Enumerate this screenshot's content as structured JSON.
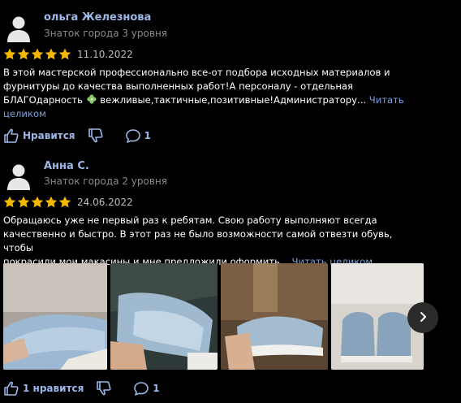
{
  "reviews": [
    {
      "author": "ольга Железнова",
      "level": "Знаток города 3 уровня",
      "rating": 5,
      "date": "11.10.2022",
      "text_line1": "В этой мастерской профессионально все-от подбора исходных материалов и",
      "text_line2": "фурнитуры до качества выполненных работ!А персоналу - отдельная",
      "text_line3_a": "БЛАГОдарность",
      "text_line3_b": " вежливые,тактичные,позитивные!Администратору...",
      "more_label_1": " Читать",
      "more_label_2": "целиком",
      "like_label": "Нравится",
      "comments_count": "1"
    },
    {
      "author": "Анна С.",
      "level": "Знаток города 2 уровня",
      "rating": 5,
      "date": "24.06.2022",
      "text_line1": "Обращаюсь уже не первый раз к ребятам. Свою работу выполняют всегда",
      "text_line2": "качественно и быстро. В этот раз не было возможности самой отвезти обувь, чтобы",
      "text_line3": "покрасили мои макасины и мне предложили оформить...",
      "more_label": " Читать целиком",
      "like_label": "1 нравится",
      "comments_count": "1",
      "photos": [
        {
          "name": "Photo 1",
          "color": "#8fa6bd"
        },
        {
          "name": "Photo 2",
          "color": "#6f8aa0"
        },
        {
          "name": "Photo 3",
          "color": "#7f6b52"
        },
        {
          "name": "Photo 4",
          "color": "#cfc8c0"
        }
      ]
    }
  ],
  "colors": {
    "background": "#000000",
    "accent": "#9cb7e8",
    "star": "#f5b800"
  }
}
